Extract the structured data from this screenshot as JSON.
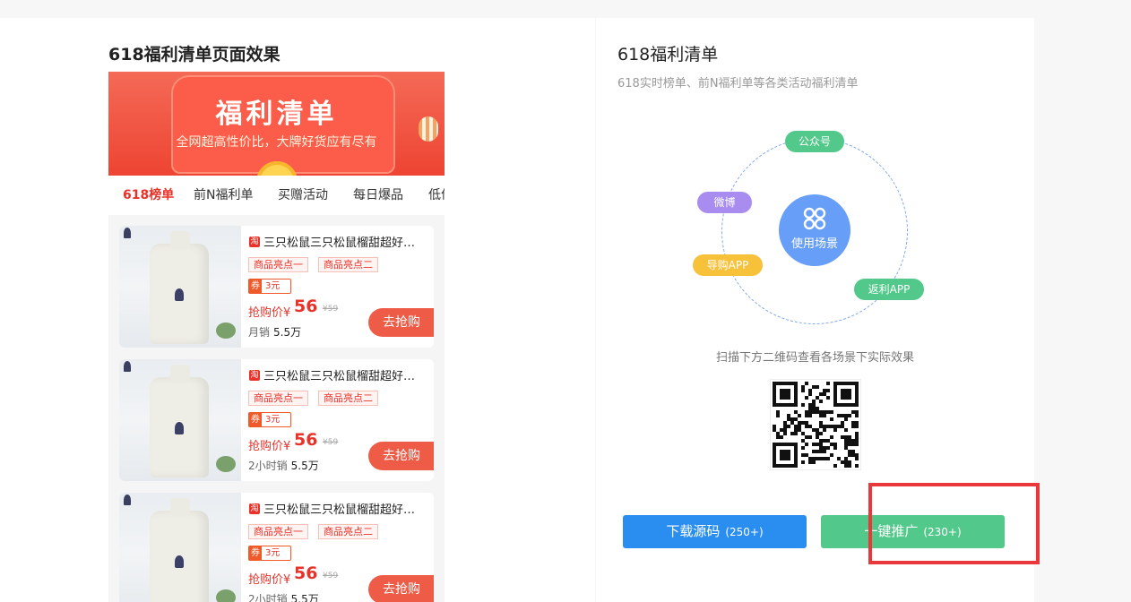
{
  "preview": {
    "page_title": "618福利清单页面效果",
    "banner": {
      "title": "福利清单",
      "subtitle": "全网超高性价比，大牌好货应有尽有"
    },
    "tabs": [
      "618榜单",
      "前N福利单",
      "买赠活动",
      "每日爆品",
      "低价"
    ],
    "active_tab": "618榜单",
    "items": [
      {
        "title": "三只松鼠三只松鼠榴甜超好吃...",
        "platform_icon": "淘",
        "tags": [
          "商品亮点一",
          "商品亮点二"
        ],
        "coupon_label": "券",
        "coupon_value": "3元",
        "price_label": "抢购价¥",
        "price": "56",
        "original_price": "¥59",
        "sales_label": "月销",
        "sales_value": "5.5万",
        "buy_label": "去抢购"
      },
      {
        "title": "三只松鼠三只松鼠榴甜超好吃...",
        "platform_icon": "淘",
        "tags": [
          "商品亮点一",
          "商品亮点二"
        ],
        "coupon_label": "券",
        "coupon_value": "3元",
        "price_label": "抢购价¥",
        "price": "56",
        "original_price": "¥59",
        "sales_label": "2小时销",
        "sales_value": "5.5万",
        "buy_label": "去抢购"
      },
      {
        "title": "三只松鼠三只松鼠榴甜超好吃...",
        "platform_icon": "淘",
        "tags": [
          "商品亮点一",
          "商品亮点二"
        ],
        "coupon_label": "券",
        "coupon_value": "3元",
        "price_label": "抢购价¥",
        "price": "56",
        "original_price": "¥59",
        "sales_label": "2小时销",
        "sales_value": "5.5万",
        "buy_label": "去抢购"
      }
    ]
  },
  "info": {
    "title": "618福利清单",
    "subtitle": "618实时榜单、前N福利单等各类活动福利清单",
    "scenes": {
      "center_label": "使用场景",
      "center_icon": "app-grid-icon",
      "channels": [
        "公众号",
        "微博",
        "导购APP",
        "返利APP"
      ],
      "colors": {
        "公众号": "#52c88a",
        "微博": "#a98cf0",
        "导购APP": "#f7c23a",
        "返利APP": "#52c88a",
        "center": "#679ef7"
      }
    },
    "scan_hint": "扫描下方二维码查看各场景下实际效果",
    "qr_icon": "qr-code-icon",
    "download_button": {
      "label": "下载源码",
      "count": "(250+)",
      "color": "#2a8ef0"
    },
    "promote_button": {
      "label": "一键推广",
      "count": "(230+)",
      "color": "#52c88a"
    }
  },
  "colors": {
    "accent_red": "#e8322a",
    "highlight_box": "#e9373b"
  }
}
